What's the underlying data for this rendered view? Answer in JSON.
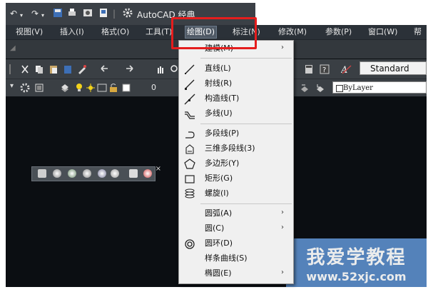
{
  "titlebar": {
    "app_title": "AutoCAD 经典"
  },
  "menubar": {
    "items": [
      "视图(V)",
      "插入(I)",
      "格式(O)",
      "工具(T)",
      "绘图(D)",
      "标注(N)",
      "修改(M)",
      "参数(P)",
      "窗口(W)"
    ]
  },
  "toolbar": {
    "style_value": "Standard",
    "layer_value": "0",
    "linetype_value": "ByLayer"
  },
  "draw_menu": {
    "items": [
      {
        "label": "建模(M)",
        "submenu": true,
        "icon": "none"
      },
      {
        "label": "直线(L)",
        "submenu": false,
        "icon": "line-icon"
      },
      {
        "label": "射线(R)",
        "submenu": false,
        "icon": "ray-icon"
      },
      {
        "label": "构造线(T)",
        "submenu": false,
        "icon": "construction-line-icon"
      },
      {
        "label": "多线(U)",
        "submenu": false,
        "icon": "multiline-icon"
      },
      {
        "label": "多段线(P)",
        "submenu": false,
        "icon": "polyline-icon"
      },
      {
        "label": "三维多段线(3)",
        "submenu": false,
        "icon": "3d-polyline-icon"
      },
      {
        "label": "多边形(Y)",
        "submenu": false,
        "icon": "polygon-icon"
      },
      {
        "label": "矩形(G)",
        "submenu": false,
        "icon": "rectangle-icon"
      },
      {
        "label": "螺旋(I)",
        "submenu": false,
        "icon": "helix-icon"
      },
      {
        "label": "圆弧(A)",
        "submenu": true,
        "icon": "none"
      },
      {
        "label": "圆(C)",
        "submenu": true,
        "icon": "none"
      },
      {
        "label": "圆环(D)",
        "submenu": false,
        "icon": "donut-icon"
      },
      {
        "label": "样条曲线(S)",
        "submenu": false,
        "icon": "none"
      },
      {
        "label": "椭圆(E)",
        "submenu": true,
        "icon": "none"
      }
    ]
  },
  "watermark": {
    "title": "我爱学教程",
    "url": "www.52xjc.com"
  },
  "colors": {
    "highlight_box": "#e51d1d",
    "workspace_bg": "#0b0e12",
    "menu_bg": "#f0f0f0"
  }
}
